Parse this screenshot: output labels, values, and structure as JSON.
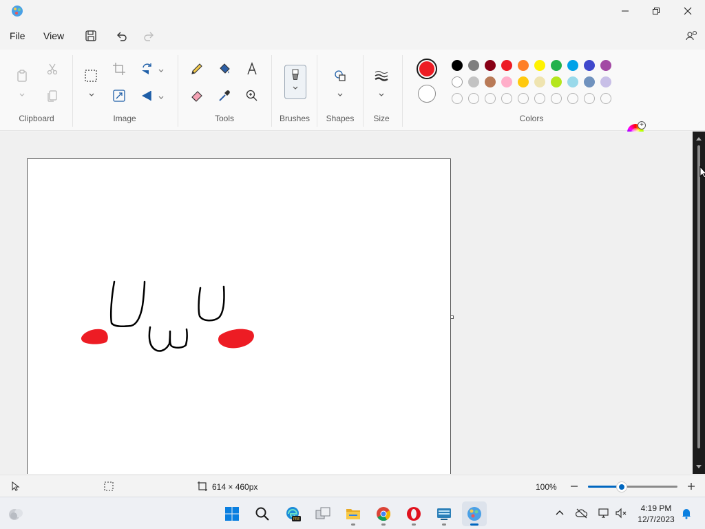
{
  "window": {
    "title": "",
    "minimize_icon": "minimize-icon",
    "restore_icon": "restore-icon",
    "close_icon": "close-icon"
  },
  "menu": {
    "file_label": "File",
    "view_label": "View"
  },
  "ribbon": {
    "groups": {
      "clipboard": "Clipboard",
      "image": "Image",
      "tools": "Tools",
      "brushes": "Brushes",
      "shapes": "Shapes",
      "size": "Size",
      "colors": "Colors"
    }
  },
  "colors": {
    "primary": "#ed1c24",
    "secondary": "#ffffff",
    "palette_row1": [
      "#000000",
      "#7f7f7f",
      "#880015",
      "#ed1c24",
      "#ff7f27",
      "#fff200",
      "#22b14c",
      "#00a2e8",
      "#3f48cc",
      "#a349a4"
    ],
    "palette_row2": [
      "#ffffff",
      "#c3c3c3",
      "#b97a57",
      "#ffaec9",
      "#ffc90e",
      "#efe4b0",
      "#b5e61d",
      "#99d9ea",
      "#7092be",
      "#c8bfe7"
    ],
    "palette_row3_empty_count": 10
  },
  "status": {
    "canvas_size": "614 × 460px",
    "zoom": "100%",
    "zoom_level_fraction": 0.38
  },
  "taskbar": {
    "apps": [
      "start-icon",
      "search-icon",
      "edge-beta-icon",
      "task-view-icon",
      "file-explorer-icon",
      "chrome-icon",
      "opera-icon",
      "keyboard-app-icon",
      "paint-icon"
    ],
    "time": "4:19 PM",
    "date": "12/7/2023"
  }
}
